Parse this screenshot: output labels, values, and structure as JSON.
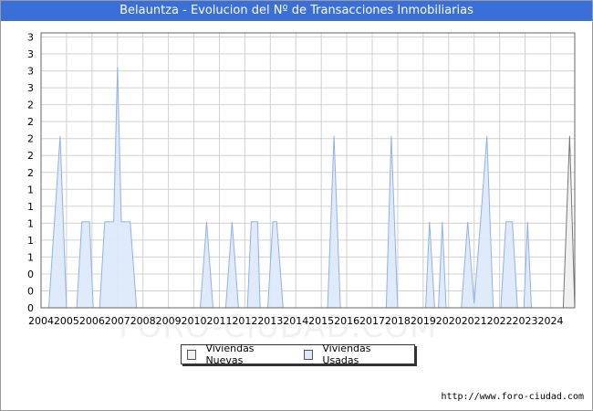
{
  "title": "Belauntza - Evolucion del Nº de Transacciones Inmobiliarias",
  "url": "http://www.foro-ciudad.com",
  "watermark": "FORO-CIUDAD.COM",
  "colors": {
    "title_bg": "#3b6fd8",
    "nuevas_fill": "#f0f0f0",
    "nuevas_stroke": "#777777",
    "usadas_fill": "#dde9fb",
    "usadas_stroke": "#8eb2e8",
    "grid": "#d0d0d0"
  },
  "chart_data": {
    "type": "area",
    "title": "Belauntza - Evolucion del Nº de Transacciones Inmobiliarias",
    "xlabel": "",
    "ylabel": "",
    "x_ticks": [
      "2004",
      "2005",
      "2006",
      "2007",
      "2008",
      "2009",
      "2010",
      "2011",
      "2012",
      "2013",
      "2014",
      "2015",
      "2016",
      "2017",
      "2018",
      "2019",
      "2020",
      "2021",
      "2022",
      "2023",
      "2024"
    ],
    "y_tick_labels": [
      "0",
      "0",
      "0",
      "1",
      "1",
      "1",
      "1",
      "1",
      "2",
      "2",
      "2",
      "2",
      "2",
      "3",
      "3",
      "3",
      "3"
    ],
    "xlim": [
      2004,
      2024.95
    ],
    "ylim": [
      0,
      3.2
    ],
    "grid": true,
    "legend_position": "bottom",
    "series": [
      {
        "name": "Viviendas Nuevas",
        "points": [
          [
            2024.5,
            0
          ],
          [
            2024.75,
            2
          ],
          [
            2024.95,
            0
          ]
        ]
      },
      {
        "name": "Viviendas Usadas",
        "points": [
          [
            2004.3,
            0
          ],
          [
            2004.75,
            2
          ],
          [
            2005.0,
            0
          ],
          [
            2005.4,
            0
          ],
          [
            2005.6,
            1
          ],
          [
            2005.9,
            1
          ],
          [
            2006.05,
            0
          ],
          [
            2006.3,
            0
          ],
          [
            2006.5,
            1
          ],
          [
            2006.85,
            1
          ],
          [
            2007.0,
            2.8
          ],
          [
            2007.15,
            1
          ],
          [
            2007.5,
            1
          ],
          [
            2007.75,
            0
          ],
          [
            2010.25,
            0
          ],
          [
            2010.5,
            1
          ],
          [
            2010.75,
            0
          ],
          [
            2011.25,
            0
          ],
          [
            2011.5,
            1
          ],
          [
            2011.75,
            0
          ],
          [
            2012.1,
            0
          ],
          [
            2012.25,
            1
          ],
          [
            2012.5,
            1
          ],
          [
            2012.6,
            0
          ],
          [
            2012.9,
            0
          ],
          [
            2013.1,
            1
          ],
          [
            2013.25,
            1
          ],
          [
            2013.5,
            0
          ],
          [
            2015.25,
            0
          ],
          [
            2015.5,
            2
          ],
          [
            2015.75,
            0
          ],
          [
            2017.55,
            0
          ],
          [
            2017.75,
            2
          ],
          [
            2018.0,
            0
          ],
          [
            2019.1,
            0
          ],
          [
            2019.25,
            1
          ],
          [
            2019.45,
            0
          ],
          [
            2019.6,
            0
          ],
          [
            2019.75,
            1
          ],
          [
            2019.9,
            0
          ],
          [
            2020.5,
            0
          ],
          [
            2020.75,
            1
          ],
          [
            2021.0,
            0.05
          ],
          [
            2021.25,
            1
          ],
          [
            2021.5,
            2
          ],
          [
            2021.75,
            0
          ],
          [
            2022.05,
            0
          ],
          [
            2022.25,
            1
          ],
          [
            2022.5,
            1
          ],
          [
            2022.7,
            0
          ],
          [
            2022.95,
            0
          ],
          [
            2023.1,
            1
          ],
          [
            2023.25,
            0
          ]
        ]
      }
    ]
  }
}
